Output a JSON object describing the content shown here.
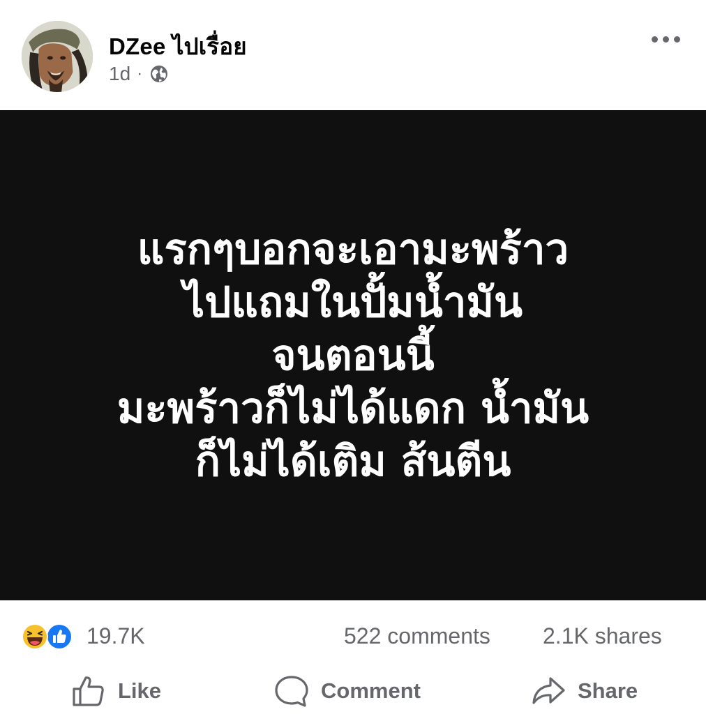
{
  "post": {
    "author": "DZee ไปเรื่อย",
    "time": "1d",
    "separator": "·",
    "privacy_icon": "globe-icon",
    "more_icon": "more-dots-icon"
  },
  "image_text": {
    "lines": [
      "แรกๆบอกจะเอามะพร้าว",
      "ไปแถมในปั้มน้ำมัน",
      "จนตอนนี้",
      "มะพร้าวก็ไม่ได้แดก น้ำมัน",
      "ก็ไม่ได้เติม ส้นตีน"
    ],
    "background_color": "#101010",
    "text_color": "#ffffff"
  },
  "stats": {
    "reaction_icons": [
      "haha-icon",
      "like-icon"
    ],
    "reactions": "19.7K",
    "comments": "522 comments",
    "shares": "2.1K shares"
  },
  "actions": {
    "like_label": "Like",
    "comment_label": "Comment",
    "share_label": "Share"
  },
  "colors": {
    "secondary_text": "#65676b",
    "like_blue": "#1877f2",
    "haha_yellow": "#f7c02d"
  }
}
